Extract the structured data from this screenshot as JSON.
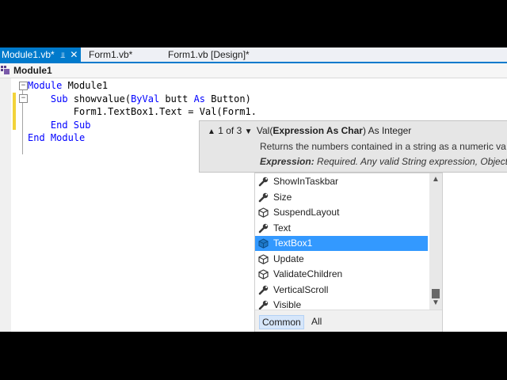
{
  "tabs": [
    {
      "label": "Module1.vb*",
      "active": true
    },
    {
      "label": "Form1.vb*",
      "active": false
    },
    {
      "label": "Form1.vb [Design]*",
      "active": false
    }
  ],
  "tab_icons": {
    "pin": "pin-icon",
    "close": "close-icon"
  },
  "navbar": {
    "label": "Module1",
    "icon": "module-icon"
  },
  "code": [
    {
      "tokens": [
        {
          "t": "Module",
          "kw": true
        },
        {
          "t": " Module1"
        }
      ]
    },
    {
      "tokens": [
        {
          "t": "    "
        },
        {
          "t": "Sub",
          "kw": true
        },
        {
          "t": " showvalue("
        },
        {
          "t": "ByVal",
          "kw": true
        },
        {
          "t": " butt "
        },
        {
          "t": "As",
          "kw": true
        },
        {
          "t": " Button)"
        }
      ]
    },
    {
      "tokens": [
        {
          "t": "        Form1.TextBox1.Text = Val(Form1."
        }
      ]
    },
    {
      "tokens": [
        {
          "t": "    "
        },
        {
          "t": "End Sub",
          "kw": true
        }
      ]
    },
    {
      "tokens": [
        {
          "t": "End Module",
          "kw": true
        }
      ]
    }
  ],
  "paraminfo": {
    "overload_counter": "1 of 3",
    "up_arrow": "▲",
    "down_arrow": "▼",
    "signature_prefix": "Val(",
    "signature_param": "Expression As Char",
    "signature_suffix": ") As Integer",
    "description": "Returns the numbers contained in a string as a numeric va",
    "param_name": "Expression:",
    "param_desc": "Required. Any valid String expression, Object t"
  },
  "completion": {
    "items": [
      {
        "label": "ShowInTaskbar",
        "icon": "property-wrench-icon",
        "selected": false
      },
      {
        "label": "Size",
        "icon": "property-wrench-icon",
        "selected": false
      },
      {
        "label": "SuspendLayout",
        "icon": "method-cube-icon",
        "selected": false
      },
      {
        "label": "Text",
        "icon": "property-wrench-icon",
        "selected": false
      },
      {
        "label": "TextBox1",
        "icon": "field-cube-icon",
        "selected": true
      },
      {
        "label": "Update",
        "icon": "method-cube-icon",
        "selected": false
      },
      {
        "label": "ValidateChildren",
        "icon": "method-cube-icon",
        "selected": false
      },
      {
        "label": "VerticalScroll",
        "icon": "property-wrench-icon",
        "selected": false
      },
      {
        "label": "Visible",
        "icon": "property-wrench-icon",
        "selected": false
      }
    ],
    "filters": [
      {
        "label": "Common",
        "active": true
      },
      {
        "label": "All",
        "active": false
      }
    ]
  },
  "colors": {
    "accent": "#007acc",
    "selection": "#3399ff",
    "keyword": "#0000ff",
    "change_marker": "#f2d33a"
  }
}
